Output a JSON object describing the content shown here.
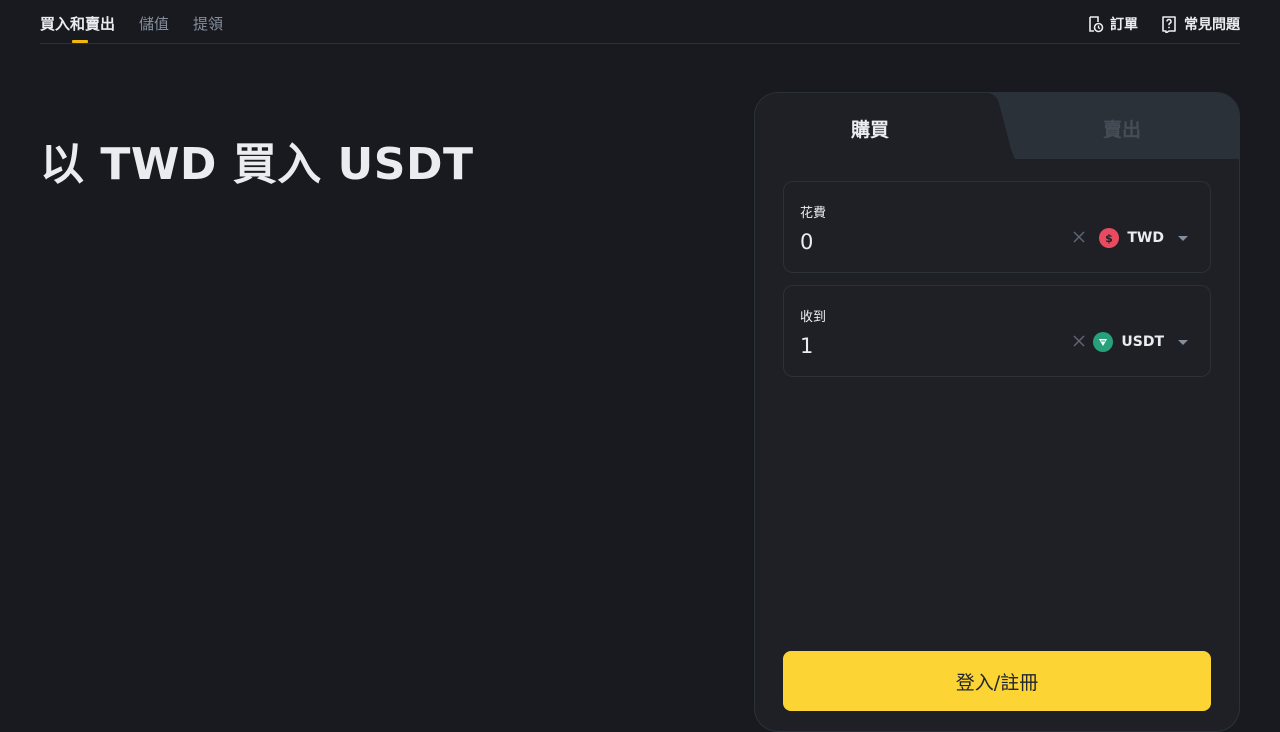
{
  "nav": {
    "tabs": [
      {
        "label": "買入和賣出",
        "active": true
      },
      {
        "label": "儲值",
        "active": false
      },
      {
        "label": "提領",
        "active": false
      }
    ],
    "links": [
      {
        "label": "訂單",
        "icon": "orders-icon"
      },
      {
        "label": "常見問題",
        "icon": "faq-icon"
      }
    ]
  },
  "hero": {
    "title": "以 TWD 買入 USDT"
  },
  "panel": {
    "tabs": {
      "buy": "購買",
      "sell": "賣出"
    },
    "spend": {
      "label": "花費",
      "value": "0",
      "currency": "TWD",
      "icon": "twd-coin-icon"
    },
    "receive": {
      "label": "收到",
      "value": "1",
      "currency": "USDT",
      "icon": "usdt-coin-icon"
    },
    "login_label": "登入/註冊"
  },
  "colors": {
    "background": "#181a20",
    "panel": "#1e2026",
    "accent": "#fcd535",
    "tab_underline": "#f0b90b",
    "twd_coin": "#e84a5f",
    "usdt_coin": "#26a17b"
  }
}
